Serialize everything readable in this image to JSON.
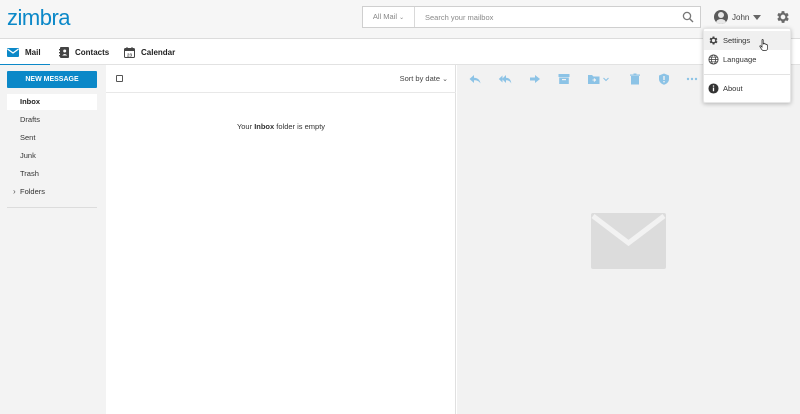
{
  "header": {
    "logo_text": "zimbra",
    "search": {
      "scope_label": "All Mail",
      "placeholder": "Search your mailbox"
    },
    "user": {
      "name": "John"
    }
  },
  "nav": {
    "tabs": [
      {
        "label": "Mail",
        "icon": "envelope-icon",
        "active": true
      },
      {
        "label": "Contacts",
        "icon": "contacts-icon"
      },
      {
        "label": "Calendar",
        "icon": "calendar-icon",
        "icon_text": "23"
      }
    ]
  },
  "sidebar": {
    "new_message_label": "NEW MESSAGE",
    "folders": [
      {
        "label": "Inbox",
        "active": true
      },
      {
        "label": "Drafts"
      },
      {
        "label": "Sent"
      },
      {
        "label": "Junk"
      },
      {
        "label": "Trash"
      },
      {
        "label": "Folders",
        "collapsible": true
      }
    ]
  },
  "message_list": {
    "sort_label": "Sort by date",
    "empty_prefix": "Your ",
    "empty_folder": "Inbox",
    "empty_suffix": " folder is empty"
  },
  "reading_pane": {
    "toolbar_icons": [
      "reply-icon",
      "reply-all-icon",
      "forward-icon",
      "archive-icon",
      "move-to-folder-icon",
      "delete-icon",
      "spam-shield-icon",
      "more-icon"
    ]
  },
  "settings_menu": {
    "items": [
      {
        "label": "Settings",
        "icon": "gear-icon"
      },
      {
        "label": "Language",
        "icon": "globe-icon"
      },
      {
        "label": "About",
        "icon": "info-icon"
      }
    ]
  },
  "colors": {
    "brand": "#0b88c8",
    "toolbar_icon": "#8cc3e6"
  }
}
